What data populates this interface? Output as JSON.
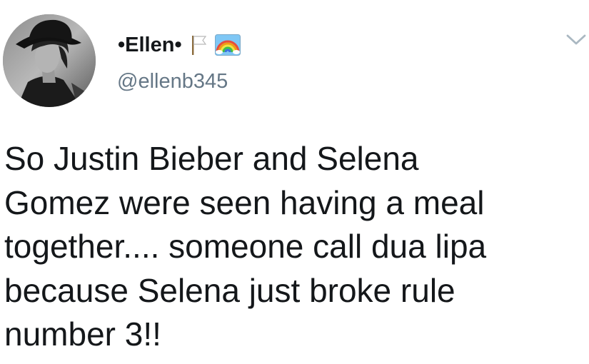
{
  "tweet": {
    "display_name": "•Ellen•",
    "handle": "@ellenb345",
    "text": "So Justin Bieber and Selena\nGomez were seen having a meal\ntogether.... someone call dua lipa\nbecause Selena just broke rule\nnumber 3!!"
  },
  "icons": {
    "avatar": "profile-photo",
    "flag": "white-flag-emoji",
    "rainbow": "rainbow-emoji",
    "menu": "chevron-down-icon"
  },
  "colors": {
    "text": "#14171a",
    "handle": "#657786",
    "caret": "#aab8c2"
  }
}
